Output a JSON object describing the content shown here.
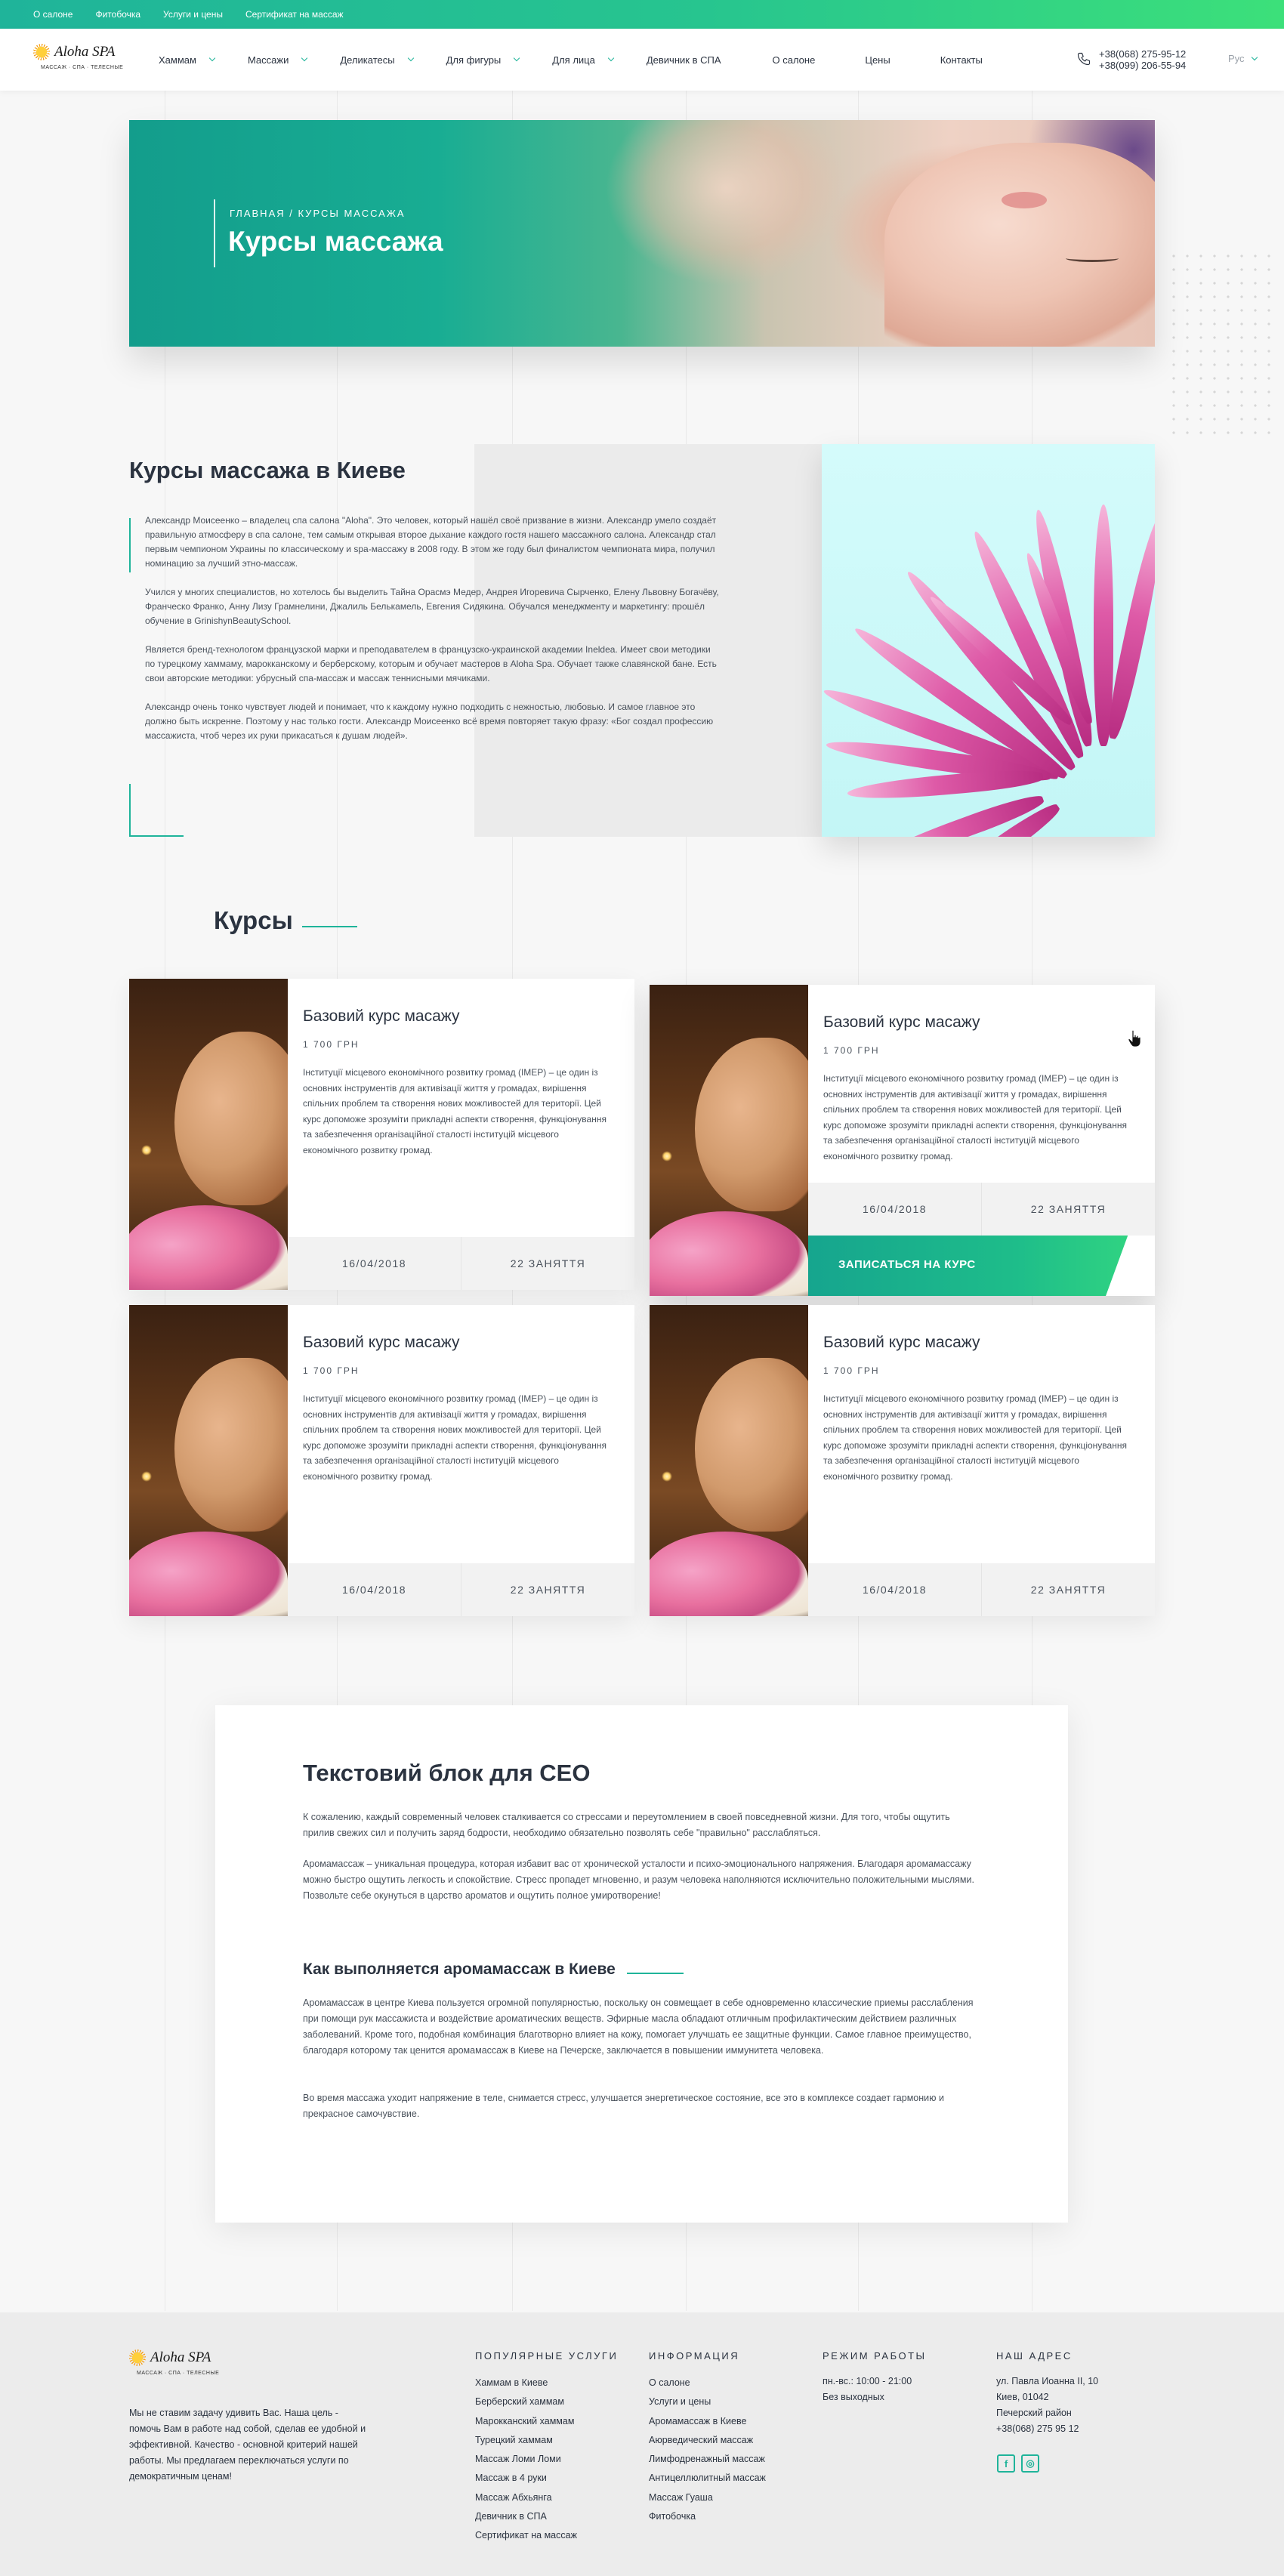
{
  "colors": {
    "accent": "#1fb49a",
    "accent_light": "#3ce07a",
    "text": "#2b3340"
  },
  "topbar": {
    "links": [
      "О салоне",
      "Фитобочка",
      "Услуги и цены",
      "Сертификат на массаж"
    ]
  },
  "logo": {
    "name": "Aloha SPA",
    "tagline": "МАССАЖ · СПА · ТЕЛЕСНЫЕ"
  },
  "nav": {
    "items": [
      {
        "label": "Хаммам",
        "dropdown": true
      },
      {
        "label": "Массажи",
        "dropdown": true
      },
      {
        "label": "Деликатесы",
        "dropdown": true
      },
      {
        "label": "Для фигуры",
        "dropdown": true
      },
      {
        "label": "Для лица",
        "dropdown": true
      },
      {
        "label": "Девичник в СПА",
        "dropdown": false
      },
      {
        "label": "О салоне",
        "dropdown": false
      },
      {
        "label": "Цены",
        "dropdown": false
      },
      {
        "label": "Контакты",
        "dropdown": false
      }
    ]
  },
  "header": {
    "phone1": "+38(068) 275-95-12",
    "phone2": "+38(099) 206-55-94",
    "lang": "Рус",
    "phone_icon": "phone-icon"
  },
  "hero": {
    "breadcrumb": "Главная / Курсы массажа",
    "title": "Курсы массажа"
  },
  "about": {
    "title": "Курсы массажа в Киеве",
    "paragraphs": [
      "Александр Моисеенко – владелец спа салона \"Aloha\". Это человек, который нашёл своё призвание в жизни. Александр умело создаёт правильную атмосферу в спа салоне, тем самым открывая второе дыхание каждого гостя нашего массажного салона. Александр стал первым чемпионом Украины по классическому и spa-массажу в 2008 году. В этом же году был финалистом чемпионата мира, получил номинацию за лучший этно-массаж.",
      "Учился у многих специалистов, но хотелось бы выделить Тайна Орасмэ Медер, Андрея Игоревича Сырченко, Елену Львовну Богачёву, Франческо Франко, Анну Лизу Грамнелини, Джалиль Белькамель, Евгения Сидякина. Обучался менеджменту и маркетингу: прошёл обучение в GrinishynBeautySchool.",
      "Является бренд-технологом французской марки и преподавателем в французско-украинской академии Ineldea. Имеет свои методики по турецкому хаммаму, марокканскому и берберскому, которым и обучает мастеров в Aloha Spa. Обучает также славянской бане. Есть свои авторские методики: убрусный спа-массаж и массаж теннисными мячиками.",
      "Александр очень тонко чувствует людей и понимает, что к каждому нужно подходить с нежностью, любовью. И самое главное это должно быть искренне. Поэтому у нас только гости. Александр Моисеенко всё время повторяет такую фразу: «Бог создал профессию массажиста, чтоб через их руки прикасаться к душам людей»."
    ]
  },
  "courses": {
    "title": "Курсы",
    "enroll_label": "ЗАПИСАТЬСЯ НА КУРС",
    "items": [
      {
        "title": "Базовий курс масажу",
        "price": "1 700 ГРН",
        "desc": "Інституції місцевого економічного розвитку громад (ІМЕР) – це один із основних інструментів для активізації життя у громадах, вирішення спільних проблем та створення нових можливостей для території. Цей курс допоможе зрозуміти прикладні аспекти створення, функціонування та забезпечення організаційної сталості інституцій місцевого економічного розвитку громад.",
        "date": "16/04/2018",
        "lessons": "22 ЗАНЯТТЯ"
      },
      {
        "title": "Базовий курс масажу",
        "price": "1 700 ГРН",
        "desc": "Інституції місцевого економічного розвитку громад (ІМЕР) – це один із основних інструментів для активізації життя у громадах, вирішення спільних проблем та створення нових можливостей для території. Цей курс допоможе зрозуміти прикладні аспекти створення, функціонування та забезпечення організаційної сталості інституцій місцевого економічного розвитку громад.",
        "date": "16/04/2018",
        "lessons": "22 ЗАНЯТТЯ"
      },
      {
        "title": "Базовий курс масажу",
        "price": "1 700 ГРН",
        "desc": "Інституції місцевого економічного розвитку громад (ІМЕР) – це один із основних інструментів для активізації життя у громадах, вирішення спільних проблем та створення нових можливостей для території. Цей курс допоможе зрозуміти прикладні аспекти створення, функціонування та забезпечення організаційної сталості інституцій місцевого економічного розвитку громад.",
        "date": "16/04/2018",
        "lessons": "22 ЗАНЯТТЯ"
      },
      {
        "title": "Базовий курс масажу",
        "price": "1 700 ГРН",
        "desc": "Інституції місцевого економічного розвитку громад (ІМЕР) – це один із основних інструментів для активізації життя у громадах, вирішення спільних проблем та створення нових можливостей для території. Цей курс допоможе зрозуміти прикладні аспекти створення, функціонування та забезпечення організаційної сталості інституцій місцевого економічного розвитку громад.",
        "date": "16/04/2018",
        "lessons": "22 ЗАНЯТТЯ"
      }
    ]
  },
  "seo": {
    "title": "Текстовий блок для СЕО",
    "p1": "К сожалению, каждый современный человек сталкивается со стрессами и переутомлением в своей повседневной жизни. Для того, чтобы ощутить прилив свежих сил и получить заряд бодрости, необходимо обязательно позволять себе \"правильно\" расслабляться.",
    "p2": "Аромамассаж – уникальная процедура, которая  избавит вас от хронической усталости и психо-эмоционального напряжения. Благодаря аромамассажу можно быстро ощутить легкость и спокойствие. Стресс пропадет мгновенно, и разум человека наполняются исключительно положительными мыслями. Позвольте себе окунуться в царство ароматов  и ощутить полное умиротворение!",
    "h3": "Как выполняется аромамассаж в Киеве",
    "p3": "Аромамассаж в центре Киева пользуется огромной популярностью, поскольку он совмещает в себе одновременно классические приемы расслабления при помощи рук массажиста и воздействие ароматических веществ. Эфирные масла обладают отличным профилактическим действием различных заболеваний. Кроме того, подобная комбинация благотворно влияет на  кожу, помогает улучшать ее защитные функции. Самое главное преимущество, благодаря которому так ценится аромамассаж в Киеве на Печерске, заключается в повышении иммунитета человека.",
    "p4": "Во время массажа уходит напряжение в теле, снимается стресс, улучшается энергетическое состояние, все это в комплексе создает гармонию и прекрасное самочувствие."
  },
  "footer": {
    "about": "Мы не ставим задачу удивить Вас. Наша цель - помочь Вам в работе над собой, сделав ее удобной и эффективной. Качество - основной критерий нашей работы. Мы предлагаем переключаться услуги по демократичным ценам!",
    "popular": {
      "title": "ПОПУЛЯРНЫЕ УСЛУГИ",
      "items": [
        "Хаммам в Киеве",
        "Берберский хаммам",
        "Марокканский хаммам",
        "Турецкий хаммам",
        "Массаж Ломи Ломи",
        "Массаж в 4 руки",
        "Массаж Абхьянга",
        "Девичник в СПА",
        "Сертификат на массаж"
      ]
    },
    "info": {
      "title": "ИНФОРМАЦИЯ",
      "items": [
        "О салоне",
        "Услуги и цены",
        "Аромамассаж в Киеве",
        "Аюрведический массаж",
        "Лимфодренажный массаж",
        "Антицеллюлитный массаж",
        "Массаж Гуаша",
        "Фитобочка"
      ]
    },
    "hours": {
      "title": "РЕЖИМ РАБОТЫ",
      "line1": "пн.-вс.: 10:00 - 21:00",
      "line2": "Без выходных"
    },
    "address": {
      "title": "НАШ АДРЕС",
      "line1": "ул. Павла Иоанна II, 10",
      "line2": "Киев, 01042",
      "line3": "Печерский район",
      "line4": "+38(068) 275 95 12"
    },
    "social": {
      "facebook": "f",
      "instagram": "◎"
    }
  }
}
